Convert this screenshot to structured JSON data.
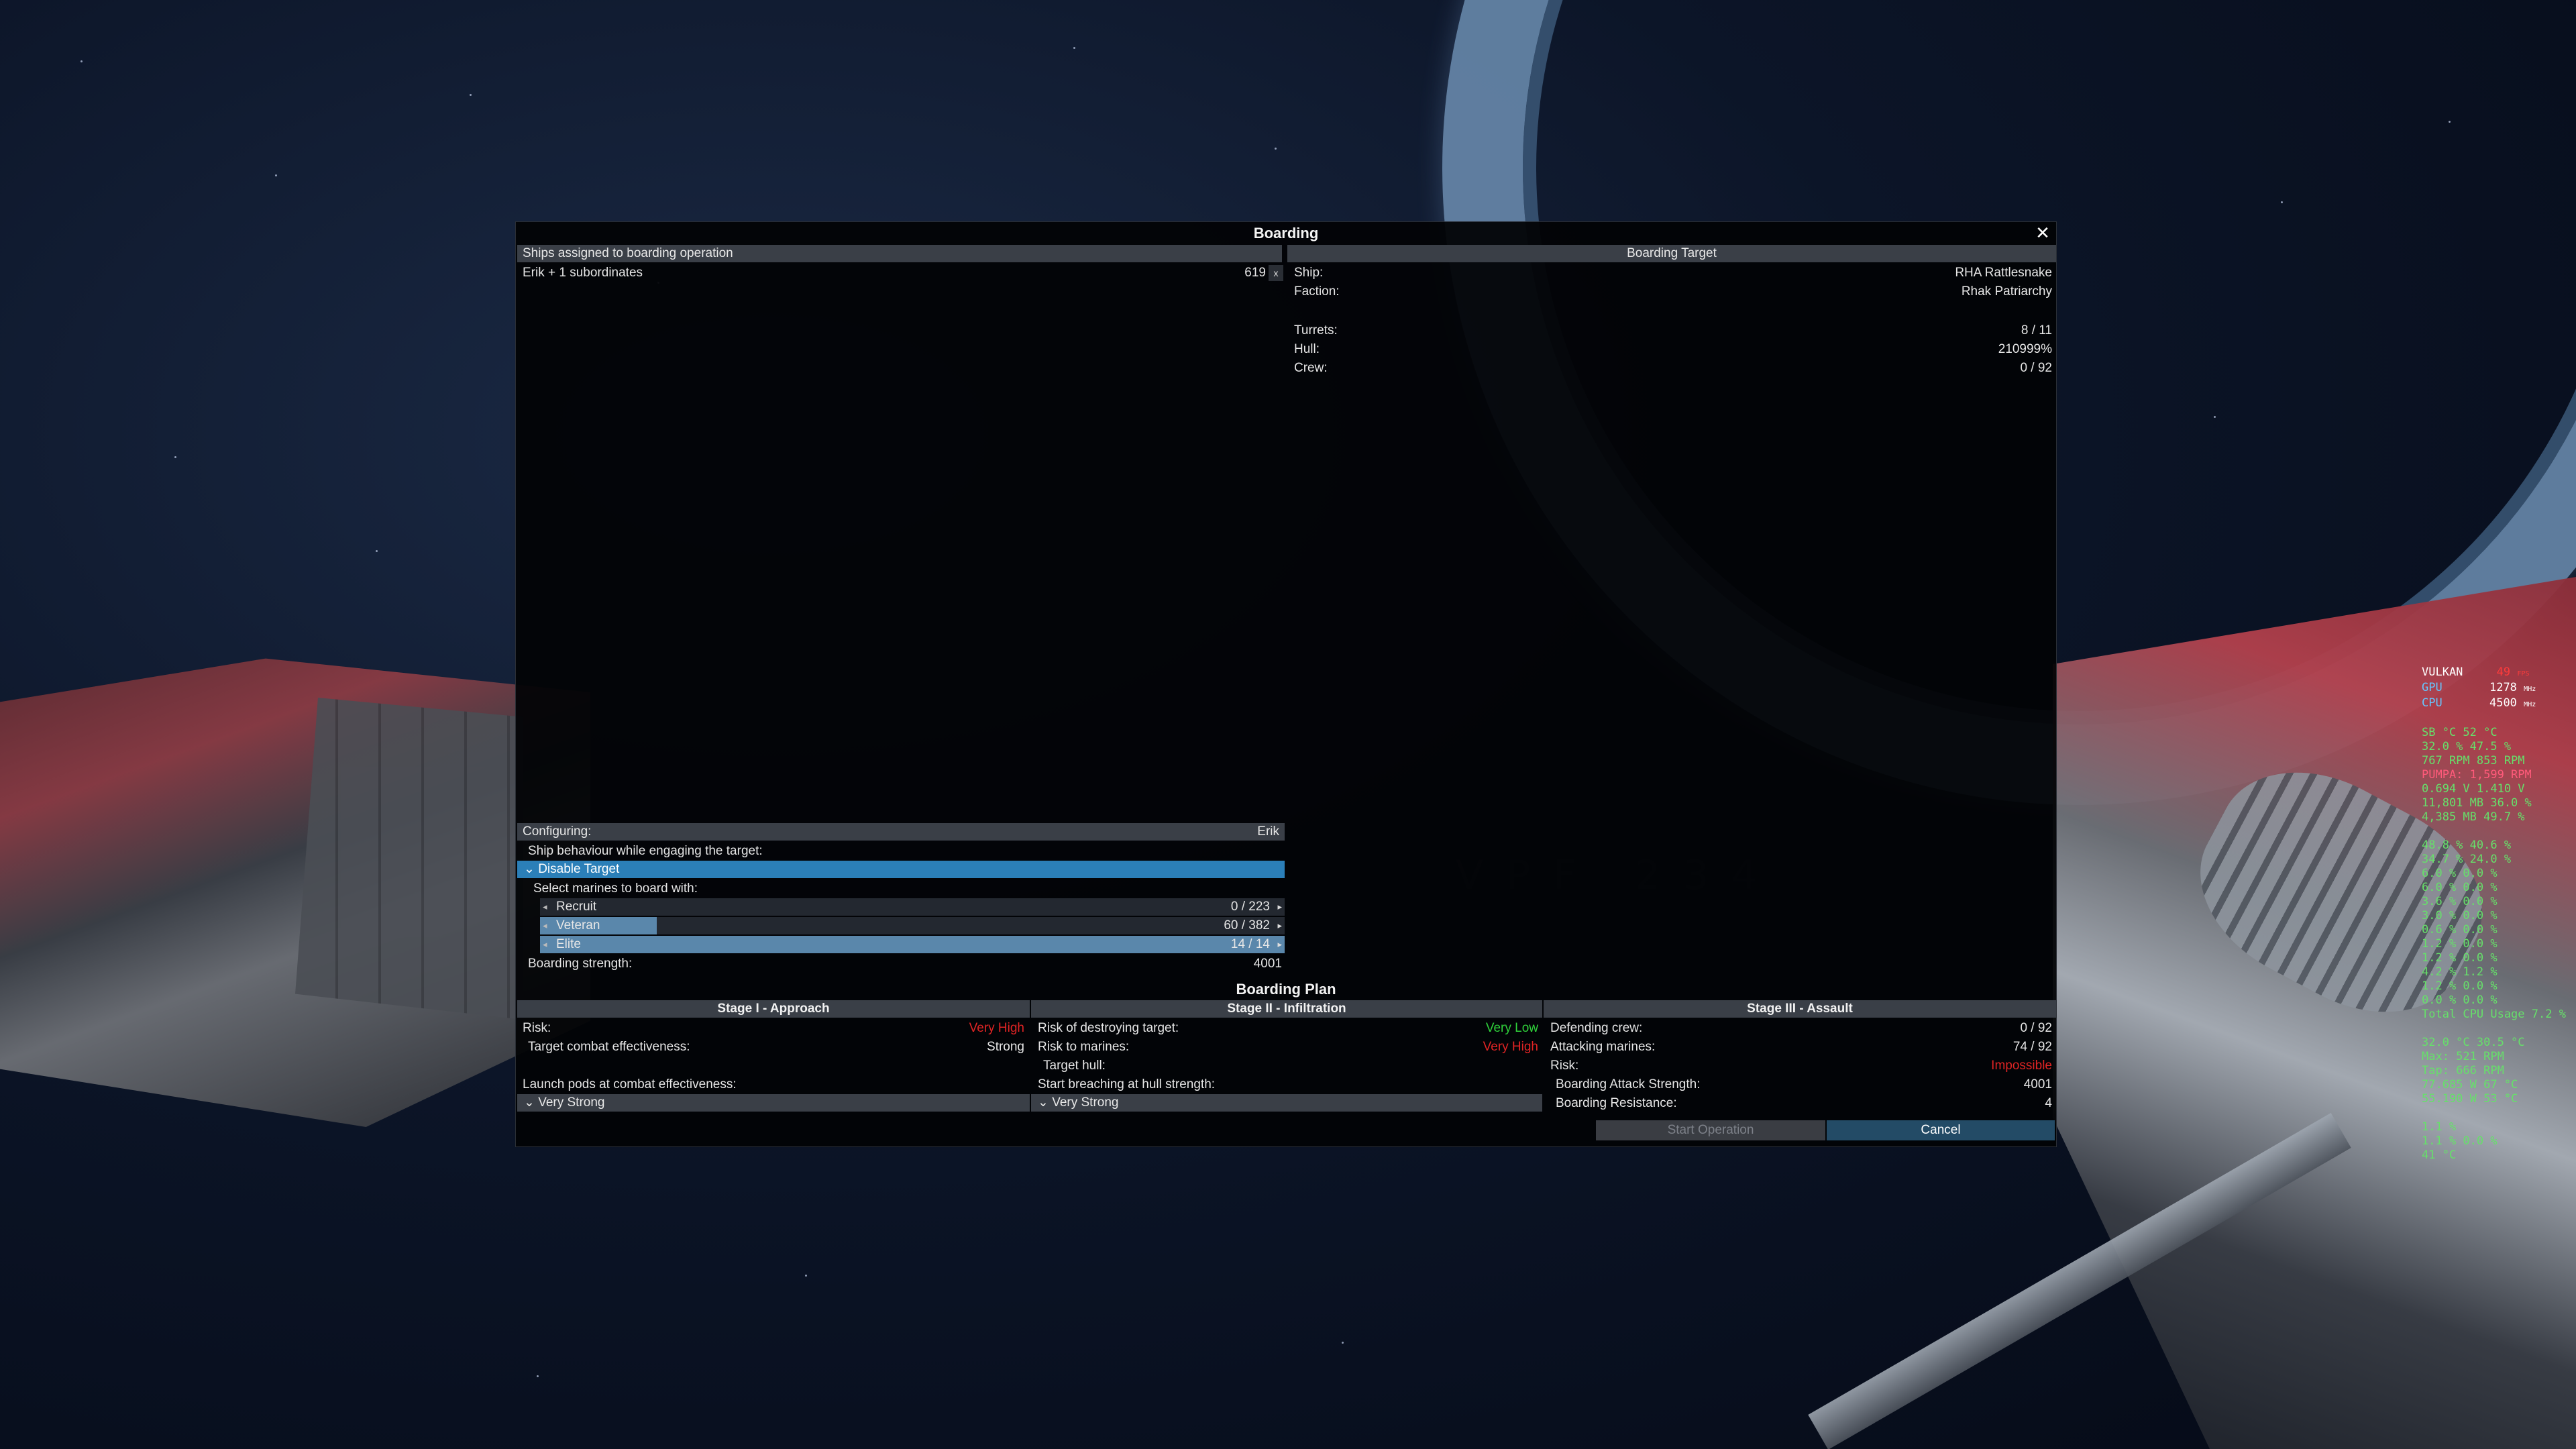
{
  "dialog": {
    "title": "Boarding",
    "close_icon": "close-icon"
  },
  "assigned": {
    "header": "Ships assigned to boarding operation",
    "ship_label": "Erik + 1 subordinates",
    "ship_value": "619",
    "collapse_glyph": "x"
  },
  "target": {
    "header": "Boarding Target",
    "rows": [
      {
        "label": "Ship:",
        "value": "RHA Rattlesnake"
      },
      {
        "label": "Faction:",
        "value": "Rhak Patriarchy"
      },
      {
        "label": "Turrets:",
        "value": "8 / 11"
      },
      {
        "label": "Hull:",
        "value": "210999%"
      },
      {
        "label": "Crew:",
        "value": "0 / 92"
      }
    ]
  },
  "configuring": {
    "label": "Configuring:",
    "value": "Erik",
    "behaviour_label": "Ship behaviour while engaging the target:",
    "behaviour_selected": "Disable Target",
    "marines_label": "Select marines to board with:",
    "marines": [
      {
        "name": "Recruit",
        "amount": "0 / 223",
        "fraction": 0.0
      },
      {
        "name": "Veteran",
        "amount": "60 / 382",
        "fraction": 0.157
      },
      {
        "name": "Elite",
        "amount": "14 / 14",
        "fraction": 1.0
      }
    ],
    "strength_label": "Boarding strength:",
    "strength_value": "4001"
  },
  "plan": {
    "title": "Boarding Plan",
    "stage1": {
      "title": "Stage I - Approach",
      "risk_label": "Risk:",
      "risk_value": "Very High",
      "effectiveness_label": "Target combat effectiveness:",
      "effectiveness_value": "Strong",
      "launch_label": "Launch pods at combat effectiveness:",
      "launch_selected": "Very Strong"
    },
    "stage2": {
      "title": "Stage II - Infiltration",
      "destroy_label": "Risk of destroying target:",
      "destroy_value": "Very Low",
      "marines_risk_label": "Risk to marines:",
      "marines_risk_value": "Very High",
      "hull_label": "Target hull:",
      "breach_label": "Start breaching at hull strength:",
      "breach_selected": "Very Strong"
    },
    "stage3": {
      "title": "Stage III - Assault",
      "defending_label": "Defending crew:",
      "defending_value": "0 / 92",
      "attacking_label": "Attacking marines:",
      "attacking_value": "74 / 92",
      "risk_label": "Risk:",
      "risk_value": "Impossible",
      "attack_label": "Boarding Attack Strength:",
      "attack_value": "4001",
      "resistance_label": "Boarding Resistance:",
      "resistance_value": "4"
    }
  },
  "buttons": {
    "start": "Start Operation",
    "cancel": "Cancel"
  },
  "perf": {
    "api": "VULKAN",
    "fps": "49",
    "fps_unit": "FPS",
    "gpu_label": "GPU",
    "gpu_value": "1278",
    "cpu_label": "CPU",
    "cpu_value": "4500",
    "unit": "MHz",
    "lines_a": [
      "SB °C 52 °C",
      "32.0 % 47.5 %",
      "767 RPM 853 RPM",
      "PUMPA: 1,599 RPM",
      "0.694 V 1.410 V",
      "11,801 MB 36.0 %",
      "4,385 MB 49.7 %"
    ],
    "lines_b": [
      "48.8 % 40.6 %",
      "34.7 % 24.0 %",
      "6.0 % 0.0 %",
      "6.0 % 0.0 %",
      "3.6 % 0.0 %",
      "3.0 % 0.0 %",
      "0.6 % 0.0 %",
      "1.2 % 0.0 %",
      "1.2 % 0.0 %",
      "4.2 % 1.2 %",
      "1.2 % 0.0 %",
      "0.0 % 0.0 %",
      "Total CPU Usage 7.2 %"
    ],
    "lines_c": [
      "32.0 °C 30.5 °C",
      "Max: 521 RPM",
      "Tap: 666 RPM",
      "77.685 W 67 °C",
      "55.190 W 53 °C"
    ],
    "lines_d": [
      "1.1 %",
      "1.1 % 0.0 %",
      "41 °C"
    ]
  }
}
